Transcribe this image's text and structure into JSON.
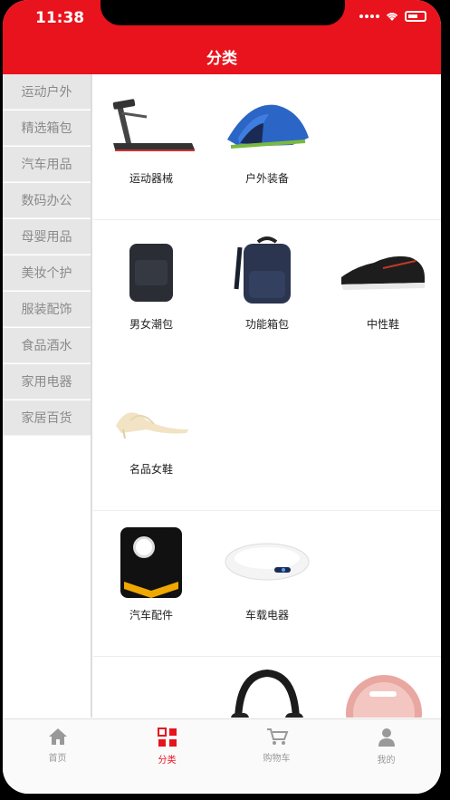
{
  "status_bar": {
    "time": "11:38"
  },
  "header": {
    "title": "分类"
  },
  "colors": {
    "accent": "#e8131c",
    "sidebar_bg": "#e6e6e6",
    "inactive": "#999999"
  },
  "sidebar": {
    "items": [
      {
        "label": "运动户外"
      },
      {
        "label": "精选箱包"
      },
      {
        "label": "汽车用品"
      },
      {
        "label": "数码办公"
      },
      {
        "label": "母婴用品"
      },
      {
        "label": "美妆个护"
      },
      {
        "label": "服装配饰"
      },
      {
        "label": "食品酒水"
      },
      {
        "label": "家用电器"
      },
      {
        "label": "家居百货"
      }
    ]
  },
  "sections": [
    {
      "items": [
        {
          "label": "运动器械",
          "icon": "treadmill-icon"
        },
        {
          "label": "户外装备",
          "icon": "tent-icon"
        }
      ]
    },
    {
      "items": [
        {
          "label": "男女潮包",
          "icon": "bag-icon"
        },
        {
          "label": "功能箱包",
          "icon": "backpack-icon"
        },
        {
          "label": "中性鞋",
          "icon": "sneaker-icon"
        },
        {
          "label": "名品女鞋",
          "icon": "heels-icon"
        }
      ]
    },
    {
      "items": [
        {
          "label": "汽车配件",
          "icon": "air-pump-icon"
        },
        {
          "label": "车载电器",
          "icon": "car-purifier-icon"
        }
      ]
    },
    {
      "items": [
        {
          "label": "",
          "icon": "device-icon"
        },
        {
          "label": "",
          "icon": "headphones-icon"
        },
        {
          "label": "",
          "icon": "robot-vacuum-icon"
        }
      ]
    }
  ],
  "tabbar": {
    "items": [
      {
        "label": "首页",
        "icon": "home-icon"
      },
      {
        "label": "分类",
        "icon": "category-icon"
      },
      {
        "label": "购物车",
        "icon": "cart-icon"
      },
      {
        "label": "我的",
        "icon": "profile-icon"
      }
    ],
    "active": "分类"
  }
}
